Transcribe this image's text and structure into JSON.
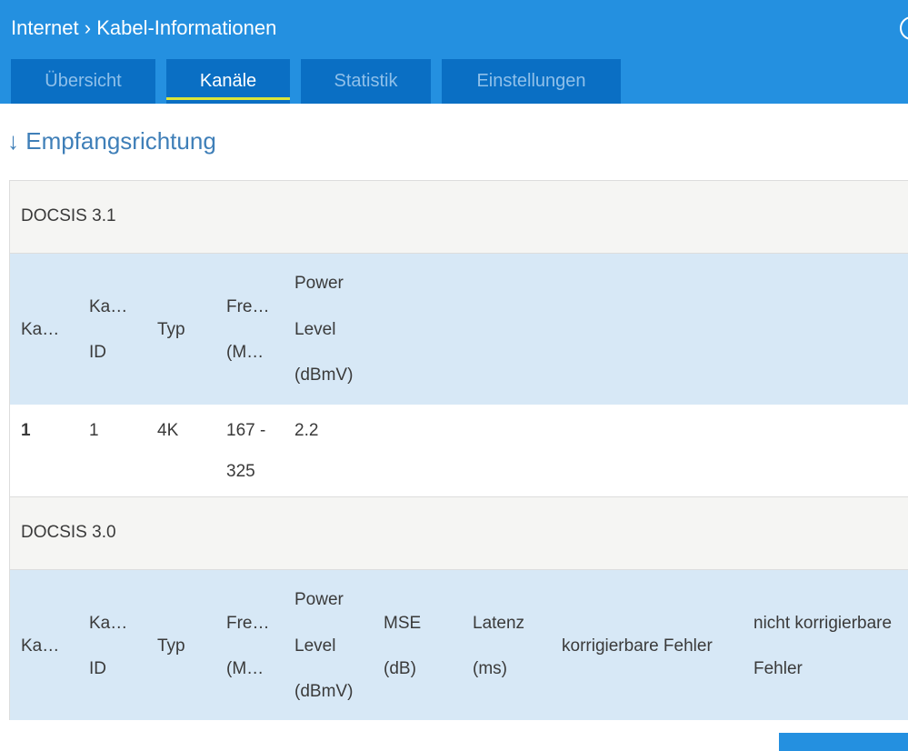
{
  "breadcrumb": {
    "parent": "Internet",
    "sep": "›",
    "current": "Kabel-Informationen"
  },
  "tabs": [
    {
      "label": "Übersicht"
    },
    {
      "label": "Kanäle",
      "active": true
    },
    {
      "label": "Statistik"
    },
    {
      "label": "Einstellungen"
    }
  ],
  "section_title": "↓ Empfangsrichtung",
  "docsis31": {
    "title": "DOCSIS 3.1",
    "headers": {
      "kanal": "Ka…",
      "id1": "Ka…",
      "id2": "ID",
      "typ": "Typ",
      "freq1": "Fre…",
      "freq2": "(M…",
      "pow1": "Power",
      "pow2": "Level",
      "pow3": "(dBmV)"
    },
    "rows": [
      {
        "kanal": "1",
        "id": "1",
        "typ": "4K",
        "freq1": "167 -",
        "freq2": "325",
        "power": "2.2"
      }
    ]
  },
  "docsis30": {
    "title": "DOCSIS 3.0",
    "headers": {
      "kanal": "Ka…",
      "id1": "Ka…",
      "id2": "ID",
      "typ": "Typ",
      "freq1": "Fre…",
      "freq2": "(M…",
      "pow1": "Power",
      "pow2": "Level",
      "pow3": "(dBmV)",
      "mse1": "MSE",
      "mse2": "(dB)",
      "lat1": "Latenz",
      "lat2": "(ms)",
      "korr": "korrigierbare Fehler",
      "nkorr1": "nicht korrigierbare",
      "nkorr2": "Fehler"
    }
  }
}
